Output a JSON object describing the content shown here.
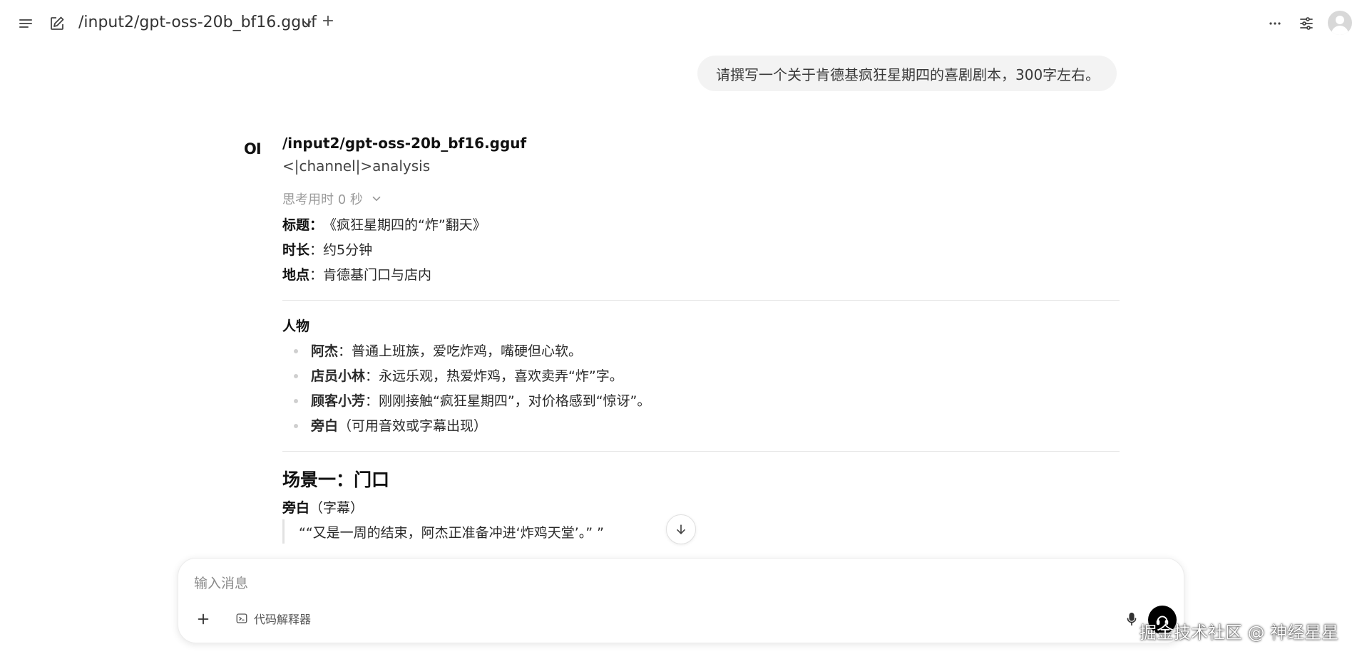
{
  "header": {
    "model_title": "/input2/gpt-oss-20b_bf16.gguf",
    "new_chat_label": "+"
  },
  "user_message": "请撰写一个关于肯德基疯狂星期四的喜剧剧本，300字左右。",
  "assistant": {
    "logo_text": "OI",
    "model_name": "/input2/gpt-oss-20b_bf16.gguf",
    "channel_line": "<|channel|>analysis",
    "thinking_label": "思考用时 0 秒",
    "meta": [
      {
        "key": "标题",
        "sep": "：",
        "value": "《疯狂星期四的“炸”翻天》"
      },
      {
        "key": "时长",
        "sep": "：",
        "value": "约5分钟"
      },
      {
        "key": "地点",
        "sep": "：",
        "value": "肯德基门口与店内"
      }
    ],
    "people_heading": "人物",
    "people": [
      {
        "name": "阿杰",
        "desc": "：普通上班族，爱吃炸鸡，嘴硬但心软。"
      },
      {
        "name": "店员小林",
        "desc": "：永远乐观，热爱炸鸡，喜欢卖弄“炸”字。"
      },
      {
        "name": "顾客小芳",
        "desc": "：刚刚接触“疯狂星期四”，对价格感到“惊讶”。"
      },
      {
        "name": "旁白",
        "desc": "（可用音效或字幕出现）"
      }
    ],
    "scene_title": "场景一：门口",
    "narrator_name": "旁白",
    "narrator_note": "（字幕）",
    "narrator_quote": "““又是一周的结束，阿杰正准备冲进‘炸鸡天堂’。” ”"
  },
  "composer": {
    "placeholder": "输入消息",
    "code_interpreter_label": "代码解释器"
  },
  "watermark": "掘金技术社区 @ 神经星星",
  "icons": {
    "menu": "menu-icon",
    "edit": "edit-icon",
    "more": "more-icon",
    "settings": "sliders-icon",
    "avatar": "user-avatar-icon",
    "chevron": "chevron-down-icon",
    "scroll": "arrow-down-icon",
    "attach": "plus-icon",
    "terminal": "terminal-icon",
    "mic": "microphone-icon",
    "send": "voice-call-icon"
  }
}
